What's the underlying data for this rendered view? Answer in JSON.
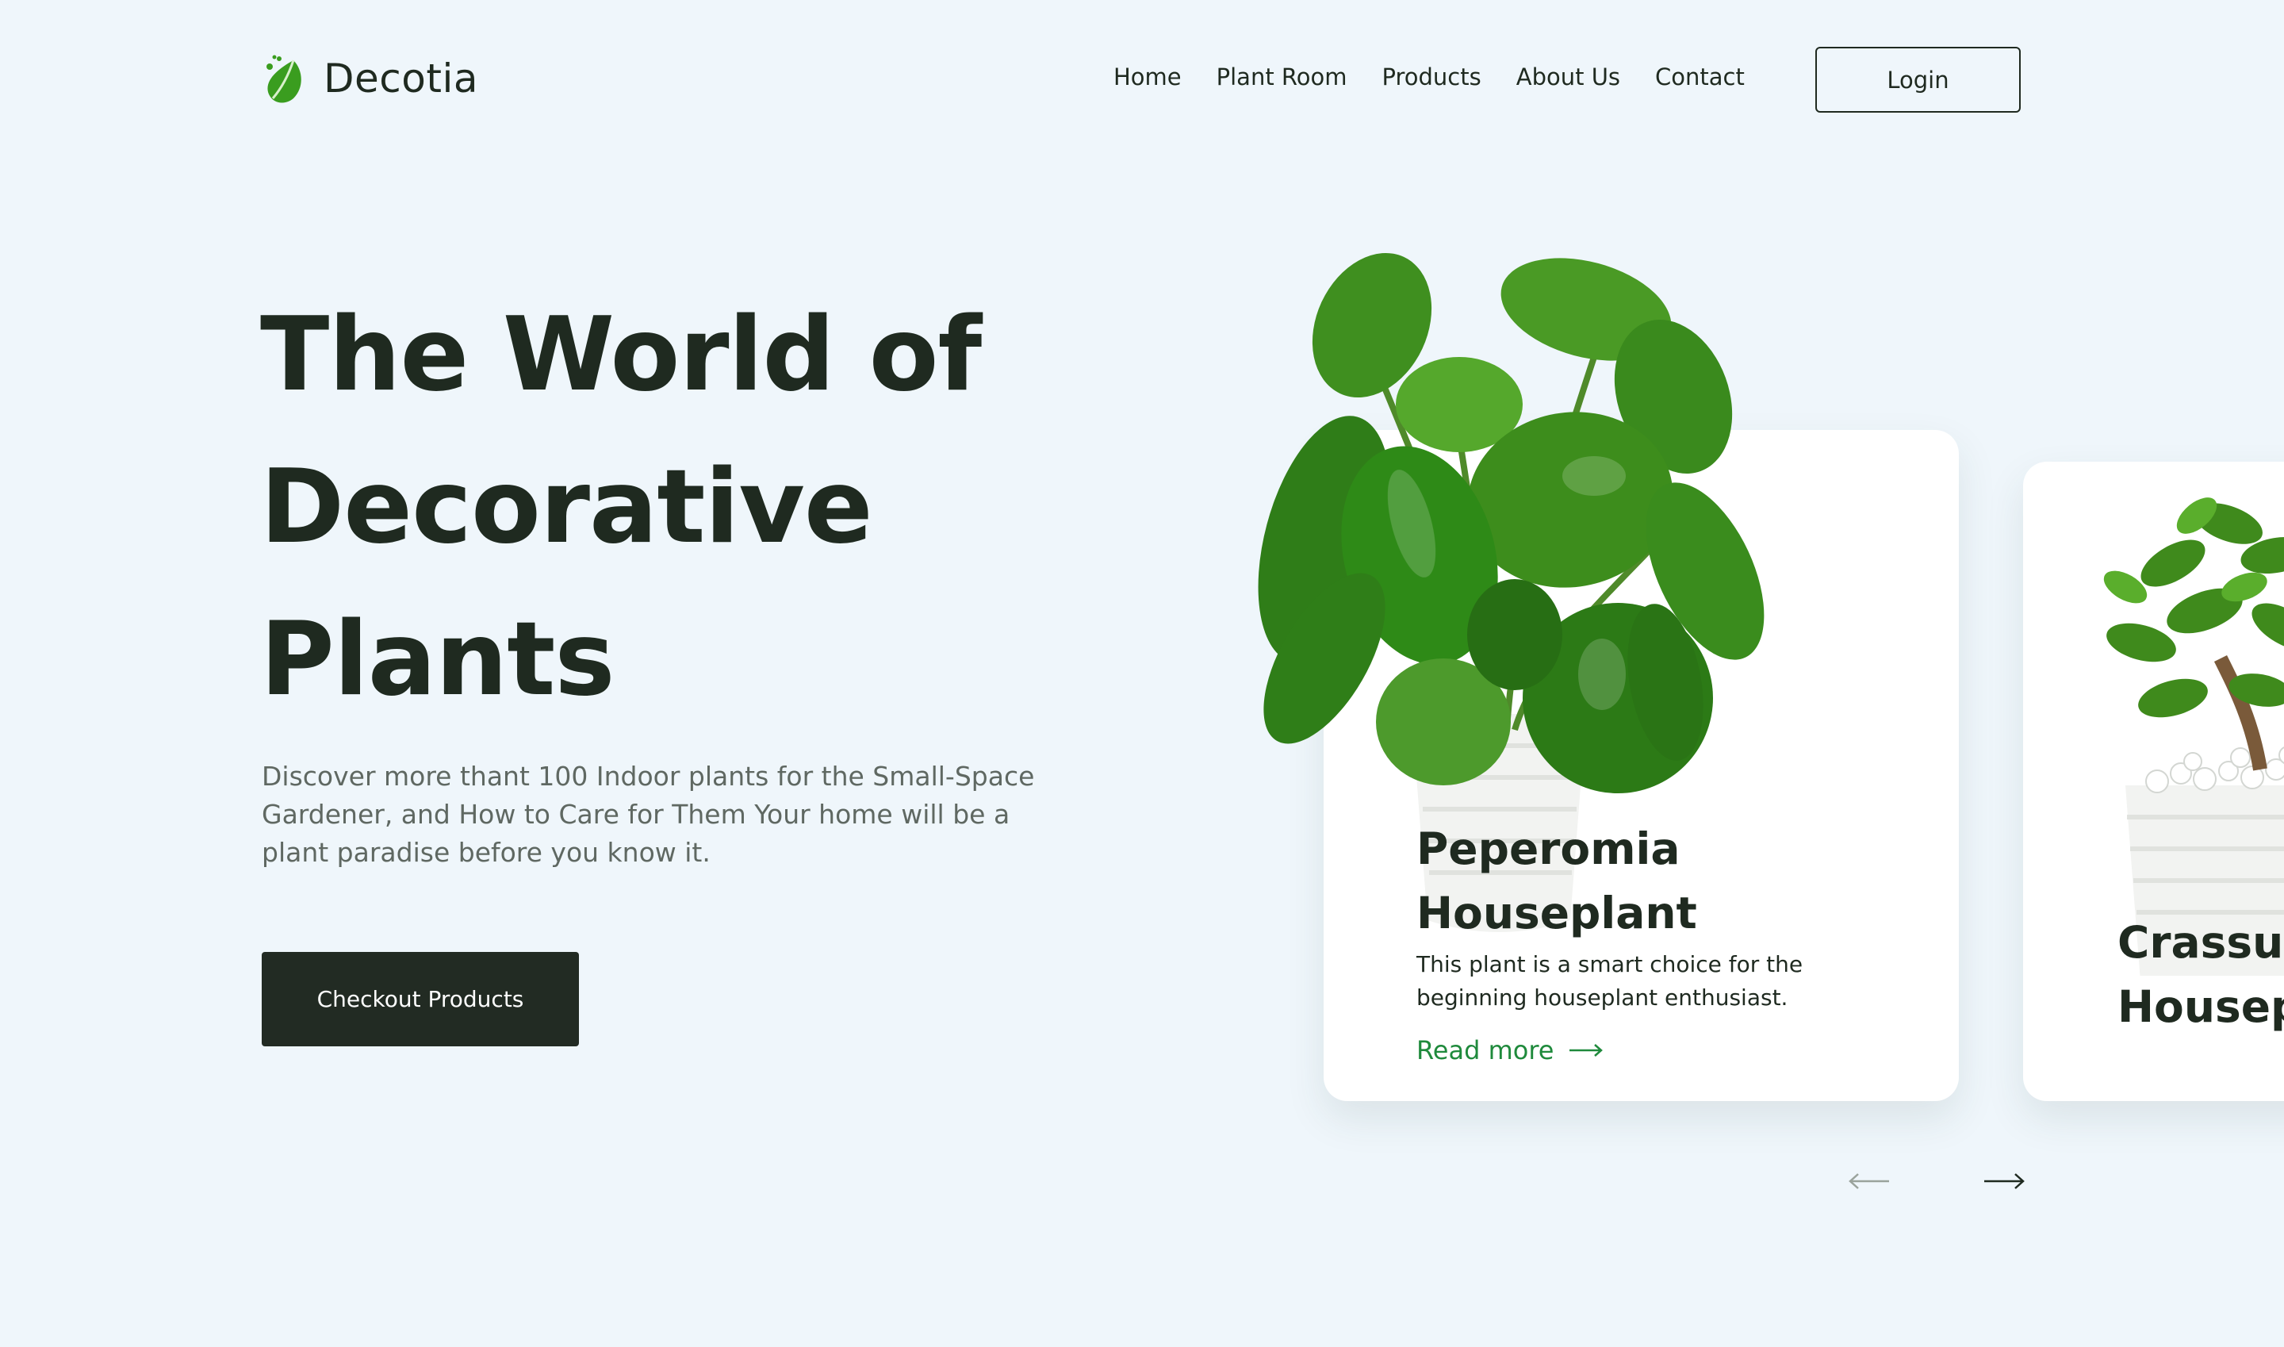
{
  "brand": {
    "name": "Decotia",
    "accent": "#3a9d1f"
  },
  "nav": {
    "items": [
      "Home",
      "Plant Room",
      "Products",
      "About Us",
      "Contact"
    ],
    "login_label": "Login"
  },
  "hero": {
    "title_lines": [
      "The World of",
      "Decorative",
      "Plants"
    ],
    "description": "Discover more thant 100 Indoor plants for the Small-Space Gardener, and How to Care for Them Your home will be a plant paradise before you know it.",
    "cta_label": "Checkout Products"
  },
  "cards": [
    {
      "title_lines": [
        "Peperomia",
        "Houseplant"
      ],
      "description": "This plant is a smart choice for the beginning houseplant enthusiast.",
      "link_label": "Read more"
    },
    {
      "title_lines": [
        "Crassul",
        "Housep"
      ]
    }
  ],
  "carousel": {
    "prev_icon": "arrow-left-icon",
    "next_icon": "arrow-right-icon"
  },
  "colors": {
    "background": "#eff6fb",
    "dark": "#222b23",
    "link": "#1f8a3c"
  }
}
